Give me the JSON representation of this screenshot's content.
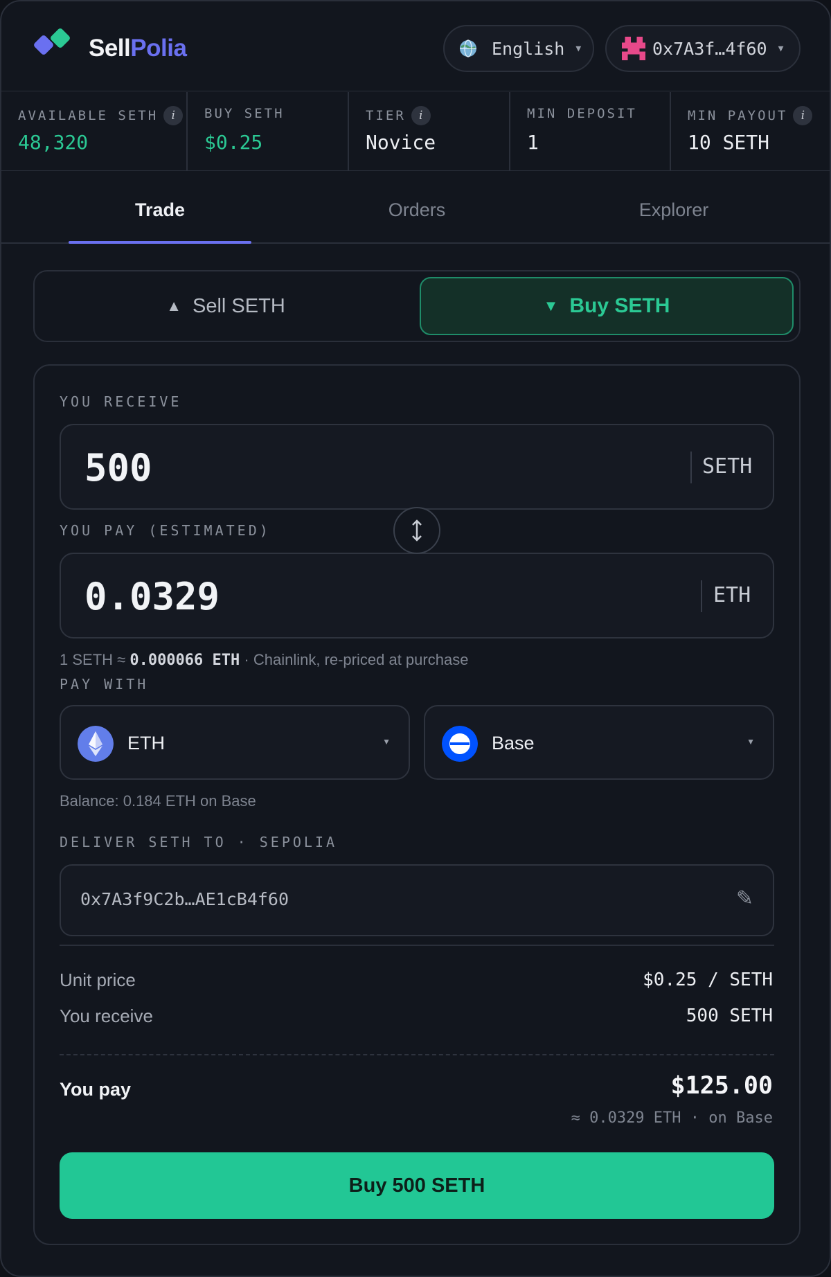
{
  "brand": {
    "part1": "Sell",
    "part2": "Polia"
  },
  "header": {
    "language": "English",
    "wallet": "0x7A3f…4f60"
  },
  "stats": [
    {
      "label": "AVAILABLE SETH",
      "value": "48,320"
    },
    {
      "label": "BUY SETH",
      "value": "$0.25"
    },
    {
      "label": "TIER",
      "value": "Novice"
    },
    {
      "label": "MIN DEPOSIT",
      "value": "1"
    },
    {
      "label": "MIN PAYOUT",
      "value": "10 SETH"
    }
  ],
  "tabs": [
    "Trade",
    "Orders",
    "Explorer"
  ],
  "toggle": {
    "sell": "Sell SETH",
    "buy": "Buy SETH"
  },
  "receive": {
    "label": "YOU RECEIVE",
    "value": "500",
    "unit": "SETH"
  },
  "pay_estimated": {
    "label": "YOU PAY (ESTIMATED)",
    "value": "0.0329",
    "unit": "ETH"
  },
  "rate": {
    "prefix": "1 SETH ≈ ",
    "amount": "0.000066 ETH",
    "suffix": " · Chainlink, re-priced at purchase"
  },
  "pay_with": {
    "label": "PAY WITH",
    "token": "ETH",
    "network": "Base"
  },
  "balance": "Balance: 0.184 ETH on Base",
  "deliver": {
    "label": "DELIVER SETH TO · SEPOLIA",
    "address": "0x7A3f9C2b…AE1cB4f60"
  },
  "summary": {
    "unit_price_label": "Unit price",
    "unit_price_value": "$0.25 / SETH",
    "receive_label": "You receive",
    "receive_value": "500 SETH",
    "pay_label": "You pay",
    "pay_value": "$125.00",
    "pay_sub": "≈ 0.0329 ETH · on Base"
  },
  "cta": "Buy 500 SETH",
  "colors": {
    "accent_purple": "#6a70f0",
    "accent_green": "#22c795",
    "background": "#12161e"
  }
}
